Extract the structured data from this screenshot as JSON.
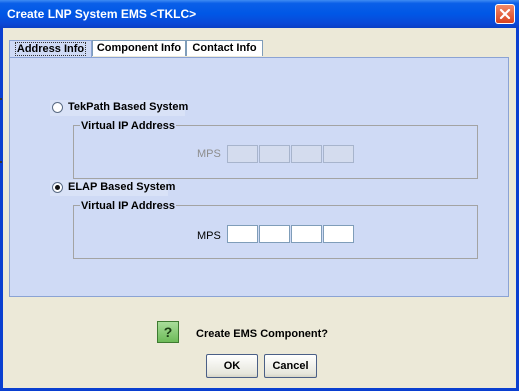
{
  "window": {
    "title": "Create LNP System EMS <TKLC>"
  },
  "tabs": [
    {
      "label": "Address Info",
      "active": true
    },
    {
      "label": "Component Info",
      "active": false
    },
    {
      "label": "Contact Info",
      "active": false
    }
  ],
  "tekpath": {
    "label": "TekPath Based System",
    "selected": false,
    "group_title": "Virtual IP Address",
    "mps_label": "MPS",
    "octets": [
      "",
      "",
      "",
      ""
    ]
  },
  "elap": {
    "label": "ELAP Based System",
    "selected": true,
    "group_title": "Virtual IP Address",
    "mps_label": "MPS",
    "octets": [
      "",
      "",
      "",
      ""
    ]
  },
  "dialog": {
    "icon": "question-icon",
    "icon_glyph": "?",
    "prompt": "Create EMS Component?",
    "ok_label": "OK",
    "cancel_label": "Cancel"
  }
}
